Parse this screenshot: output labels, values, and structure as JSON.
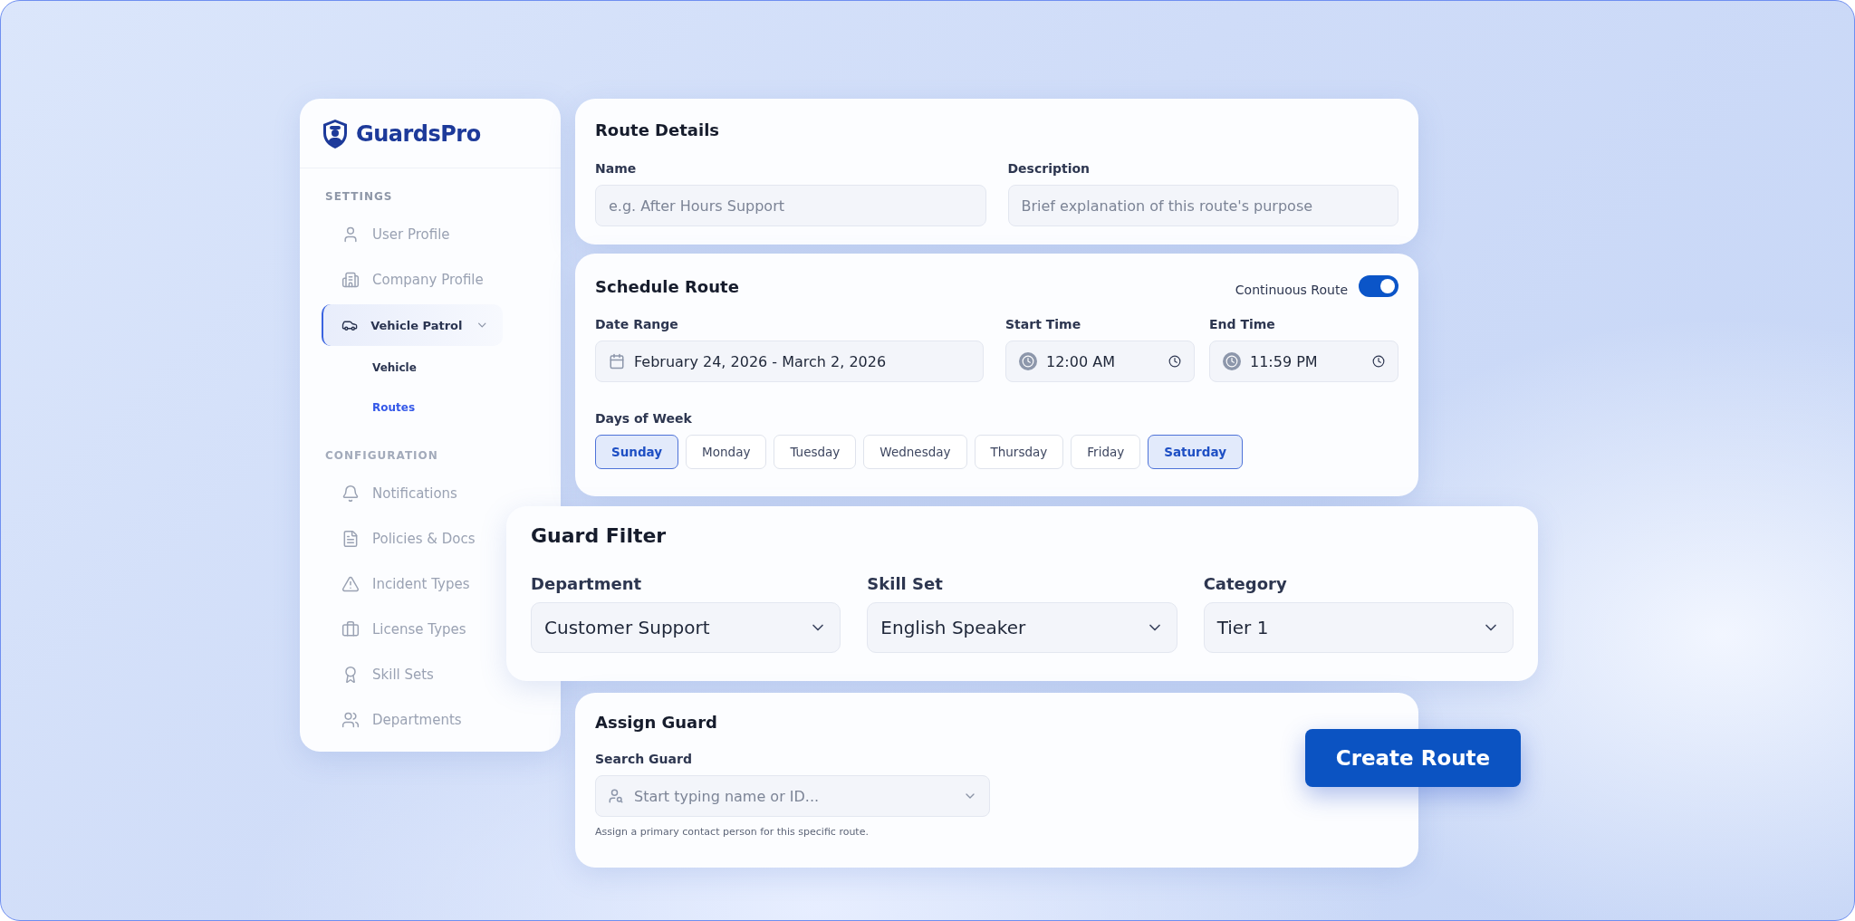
{
  "sidebar": {
    "logo": "GuardsPro",
    "sections": [
      {
        "heading": "SETTINGS",
        "faded": false,
        "items": [
          {
            "label": "User Profile",
            "faded": true,
            "selected": false
          },
          {
            "label": "Company Profile",
            "faded": true,
            "selected": false
          },
          {
            "label": "Vehicle Patrol",
            "faded": false,
            "selected": true,
            "expanded": true,
            "children": [
              {
                "label": "Vehicle",
                "selected": false
              },
              {
                "label": "Routes",
                "selected": true
              }
            ]
          }
        ]
      },
      {
        "heading": "CONFIGURATION",
        "faded": true,
        "items": [
          {
            "label": "Notifications",
            "faded": true,
            "selected": false
          },
          {
            "label": "Policies & Docs",
            "faded": true,
            "selected": false
          },
          {
            "label": "Incident Types",
            "faded": true,
            "selected": false
          },
          {
            "label": "License Types",
            "faded": true,
            "selected": false
          },
          {
            "label": "Skill Sets",
            "faded": true,
            "selected": false
          },
          {
            "label": "Departments",
            "faded": true,
            "selected": false
          }
        ]
      }
    ]
  },
  "route_details": {
    "title": "Route Details",
    "fields": [
      {
        "label": "Name",
        "placeholder": "e.g. After Hours Support"
      },
      {
        "label": "Description",
        "placeholder": "Brief explanation of this route's purpose"
      }
    ]
  },
  "schedule": {
    "title": "Schedule Route",
    "toggle": {
      "label": "Continuous Route",
      "on": true
    },
    "date_range": {
      "label": "Date Range",
      "value": "February 24, 2026 - March 2, 2026"
    },
    "start_time": {
      "label": "Start Time",
      "value": "12:00 AM"
    },
    "end_time": {
      "label": "End Time",
      "value": "11:59 PM"
    },
    "days_label": "Days of Week",
    "days": [
      {
        "label": "Sunday",
        "selected": true
      },
      {
        "label": "Monday",
        "selected": false
      },
      {
        "label": "Tuesday",
        "selected": false
      },
      {
        "label": "Wednesday",
        "selected": false
      },
      {
        "label": "Thursday",
        "selected": false
      },
      {
        "label": "Friday",
        "selected": false
      },
      {
        "label": "Saturday",
        "selected": true
      }
    ]
  },
  "guard_filter": {
    "title": "Guard Filter",
    "selects": [
      {
        "label": "Department",
        "value": "Customer Support"
      },
      {
        "label": "Skill Set",
        "value": "English Speaker"
      },
      {
        "label": "Category",
        "value": "Tier 1"
      }
    ]
  },
  "assign_guard": {
    "title": "Assign Guard",
    "search": {
      "label": "Search Guard",
      "placeholder": "Start typing name or ID..."
    },
    "hint": "Assign a primary contact person for this specific route."
  },
  "create_button": "Create Route"
}
